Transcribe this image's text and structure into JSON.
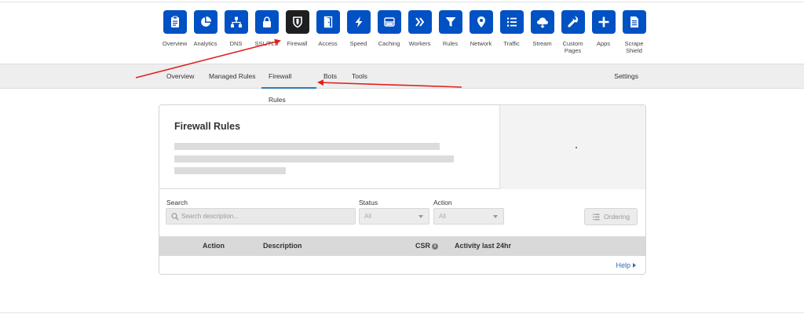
{
  "iconnav": {
    "items": [
      {
        "label": "Overview",
        "icon": "clipboard-icon"
      },
      {
        "label": "Analytics",
        "icon": "pie-chart-icon"
      },
      {
        "label": "DNS",
        "icon": "network-tree-icon"
      },
      {
        "label": "SSL/TLS",
        "icon": "lock-icon"
      },
      {
        "label": "Firewall",
        "icon": "shield-icon",
        "active": true
      },
      {
        "label": "Access",
        "icon": "door-icon"
      },
      {
        "label": "Speed",
        "icon": "lightning-icon"
      },
      {
        "label": "Caching",
        "icon": "server-icon"
      },
      {
        "label": "Workers",
        "icon": "chevrons-icon"
      },
      {
        "label": "Rules",
        "icon": "filter-icon"
      },
      {
        "label": "Network",
        "icon": "location-pin-icon"
      },
      {
        "label": "Traffic",
        "icon": "list-icon"
      },
      {
        "label": "Stream",
        "icon": "cloud-icon"
      },
      {
        "label": "Custom\nPages",
        "icon": "wrench-icon"
      },
      {
        "label": "Apps",
        "icon": "plus-icon"
      },
      {
        "label": "Scrape\nShield",
        "icon": "document-icon"
      }
    ]
  },
  "subnav": {
    "tabs": [
      "Overview",
      "Managed Rules",
      "Firewall Rules",
      "Bots",
      "Tools"
    ],
    "active": "Firewall Rules",
    "settings": "Settings"
  },
  "card": {
    "title": "Firewall Rules",
    "filters": {
      "search_label": "Search",
      "search_placeholder": "Search description...",
      "status_label": "Status",
      "status_value": "All",
      "action_label": "Action",
      "action_value": "All",
      "ordering": "Ordering"
    },
    "table": {
      "columns": [
        "Action",
        "Description",
        "CSR",
        "Activity last 24hr"
      ]
    },
    "help": "Help"
  },
  "colors": {
    "nav_icon": "#0051c3",
    "nav_icon_active": "#1d1f20",
    "active_tab_underline": "#2c7cb0",
    "annotation_arrow": "#e02020",
    "link": "#2f6cb3"
  }
}
